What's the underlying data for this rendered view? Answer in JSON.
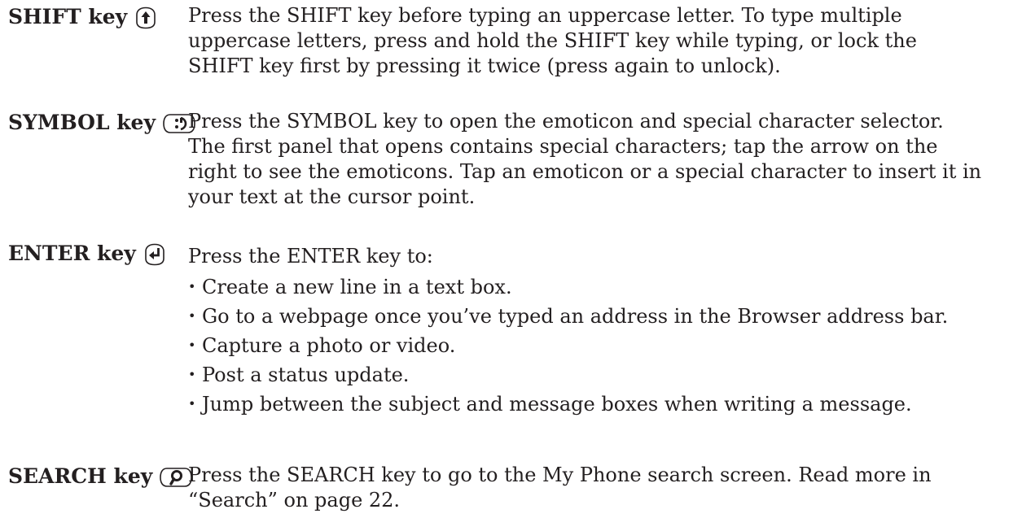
{
  "entries": [
    {
      "term": "SHIFT key",
      "icon": "shift-arrow-up-icon",
      "lines": [
        "Press the SHIFT key before typing an uppercase letter. To type multiple",
        "uppercase letters, press and hold the SHIFT key while typing, or lock the",
        "SHIFT key first by pressing it twice (press again to unlock)."
      ]
    },
    {
      "term": "SYMBOL key",
      "icon": "symbol-emoticon-icon",
      "lines": [
        "Press the SYMBOL key to open the emoticon and special character selector.",
        "The first panel that opens contains special characters; tap the arrow on the",
        "right to see the emoticons. Tap an emoticon or a special character to insert it in",
        "your text at the cursor point."
      ]
    },
    {
      "term": "ENTER key",
      "icon": "enter-return-icon",
      "lead": "Press the ENTER key to:",
      "bullets": [
        "Create a new line in a text box.",
        "Go to a webpage once you’ve typed an address in the Browser address bar.",
        "Capture a photo or video.",
        "Post a status update.",
        "Jump between the subject and message boxes when writing a message."
      ]
    },
    {
      "term": "SEARCH key",
      "icon": "search-magnifier-icon",
      "lines": [
        "Press the SEARCH key to go to the My Phone search screen. Read more in",
        "“Search” on page 22."
      ]
    }
  ]
}
